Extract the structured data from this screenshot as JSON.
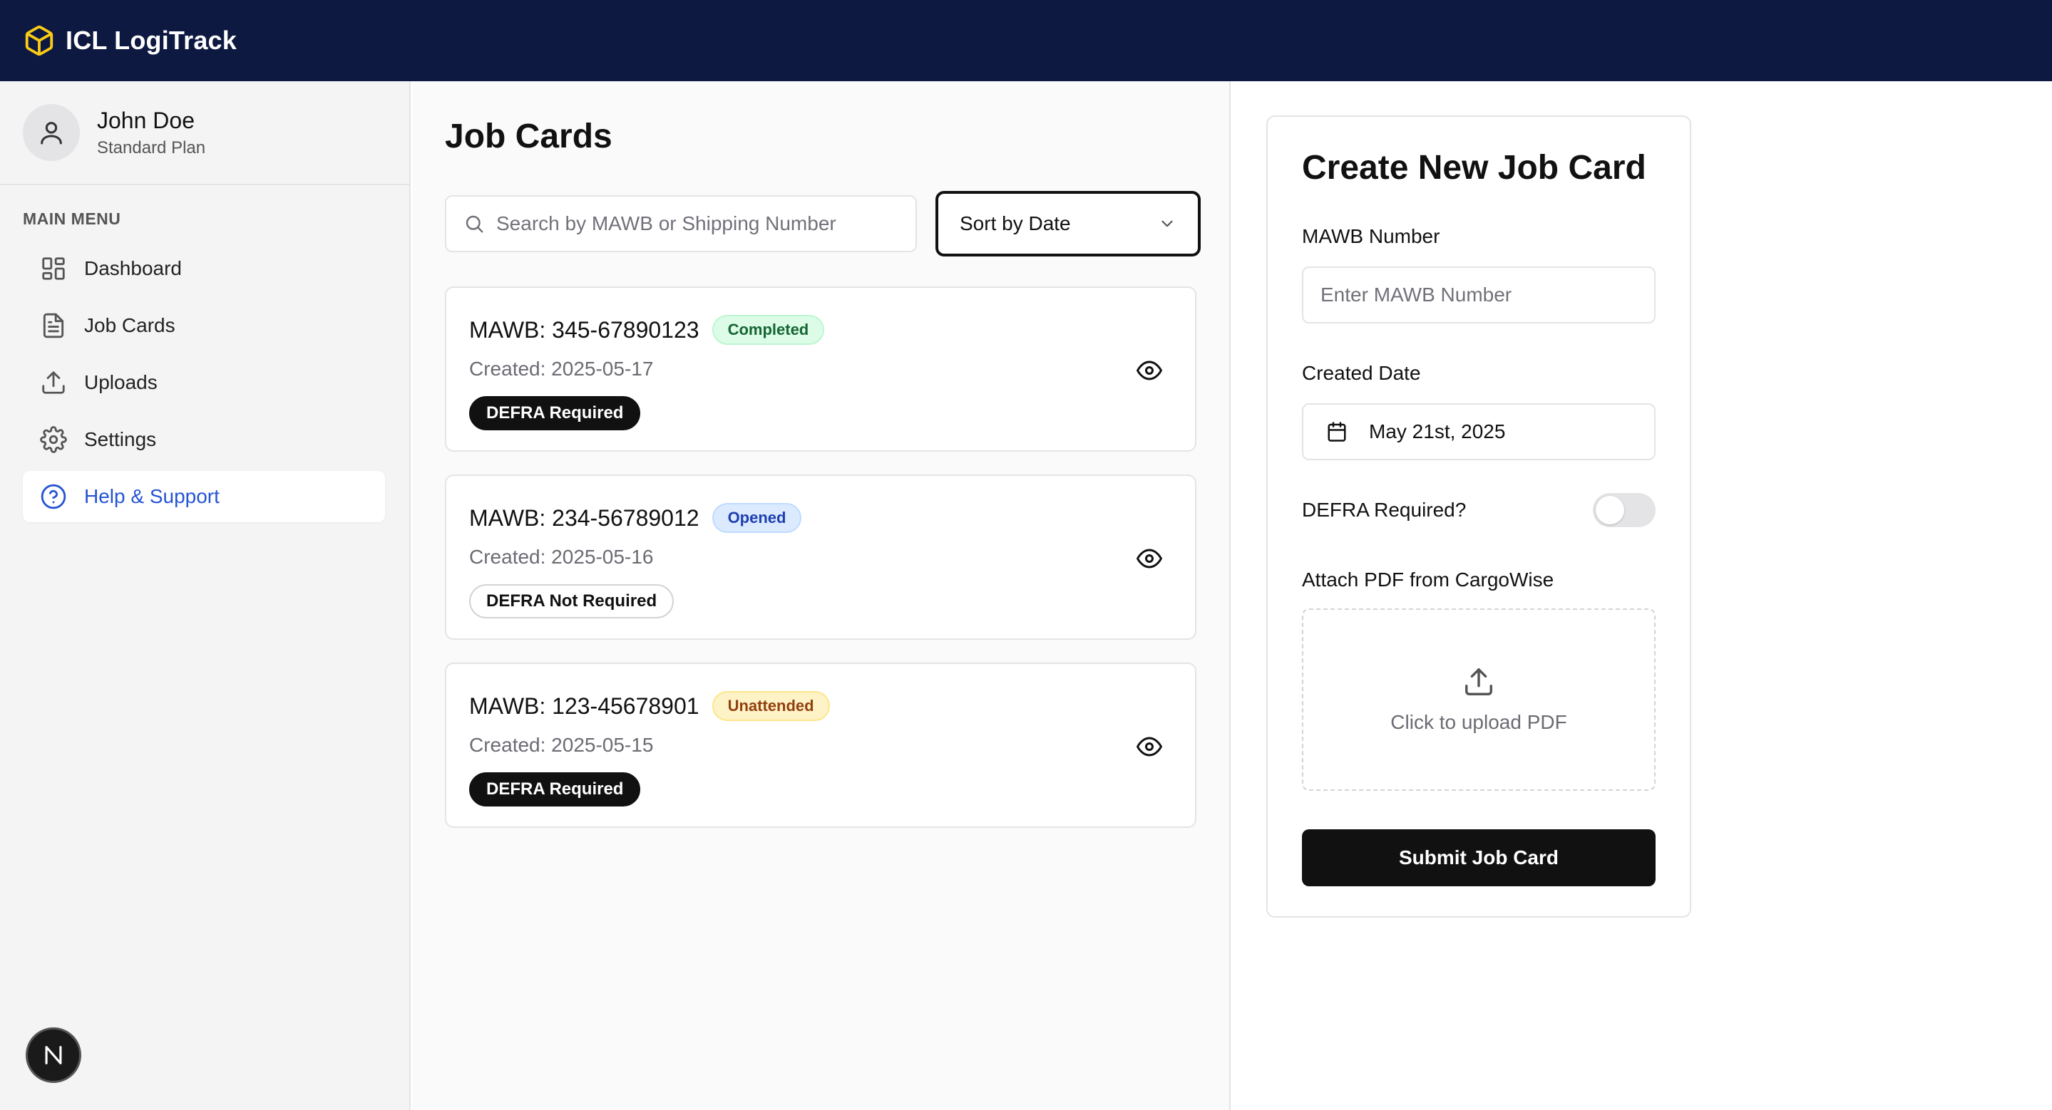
{
  "app": {
    "title": "ICL LogiTrack",
    "icon": "cube-icon",
    "brand_color": "#0e1941"
  },
  "user": {
    "name": "John Doe",
    "plan": "Standard Plan",
    "avatar_icon": "user-icon"
  },
  "sidebar": {
    "section_title": "MAIN MENU",
    "items": [
      {
        "label": "Dashboard",
        "icon": "dashboard-grid-icon",
        "active": false
      },
      {
        "label": "Job Cards",
        "icon": "document-icon",
        "active": false
      },
      {
        "label": "Uploads",
        "icon": "upload-icon",
        "active": false
      },
      {
        "label": "Settings",
        "icon": "gear-icon",
        "active": false
      },
      {
        "label": "Help & Support",
        "icon": "help-circle-icon",
        "active": true
      }
    ],
    "floating_badge": "N"
  },
  "main": {
    "title": "Job Cards",
    "search": {
      "placeholder": "Search by MAWB or Shipping Number",
      "value": ""
    },
    "sort": {
      "selected": "Sort by Date"
    },
    "cards": [
      {
        "mawb": "MAWB: 345-67890123",
        "status": "Completed",
        "created": "Created: 2025-05-17",
        "defra": "DEFRA Required"
      },
      {
        "mawb": "MAWB: 234-56789012",
        "status": "Opened",
        "created": "Created: 2025-05-16",
        "defra": "DEFRA Not Required"
      },
      {
        "mawb": "MAWB: 123-45678901",
        "status": "Unattended",
        "created": "Created: 2025-05-15",
        "defra": "DEFRA Required"
      }
    ]
  },
  "form": {
    "title": "Create New Job Card",
    "mawb_label": "MAWB Number",
    "mawb_placeholder": "Enter MAWB Number",
    "date_label": "Created Date",
    "date_value": "May 21st, 2025",
    "defra_label": "DEFRA Required?",
    "defra_toggle_on": false,
    "attach_label": "Attach PDF from CargoWise",
    "upload_text": "Click to upload PDF",
    "submit_label": "Submit Job Card"
  },
  "colors": {
    "completed": "#166534",
    "opened": "#1e40af",
    "unattended": "#92400e",
    "active_nav": "#2554d4",
    "primary_button": "#111111"
  }
}
